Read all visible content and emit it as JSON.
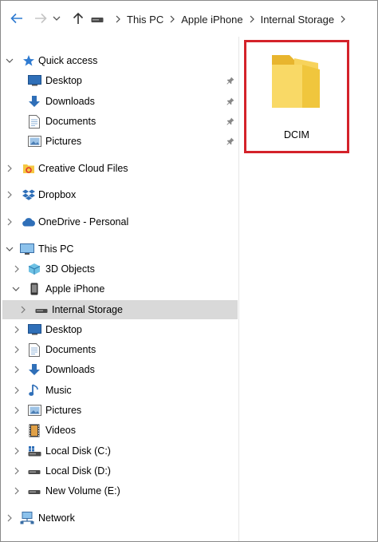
{
  "breadcrumb": [
    "This PC",
    "Apple iPhone",
    "Internal Storage"
  ],
  "colors": {
    "accent": "#2f7bd1",
    "selection": "#d9d9d9",
    "highlight_border": "#d4222a",
    "folder": "#f5c842"
  },
  "nav": {
    "quick_access": {
      "label": "Quick access",
      "items": [
        {
          "label": "Desktop",
          "icon": "desktop-icon",
          "pinned": true
        },
        {
          "label": "Downloads",
          "icon": "downloads-icon",
          "pinned": true
        },
        {
          "label": "Documents",
          "icon": "documents-icon",
          "pinned": true
        },
        {
          "label": "Pictures",
          "icon": "pictures-icon",
          "pinned": true
        }
      ]
    },
    "creative_cloud": {
      "label": "Creative Cloud Files",
      "icon": "creative-cloud-icon"
    },
    "dropbox": {
      "label": "Dropbox",
      "icon": "dropbox-icon"
    },
    "onedrive": {
      "label": "OneDrive - Personal",
      "icon": "onedrive-icon"
    },
    "this_pc": {
      "label": "This PC",
      "items": [
        {
          "label": "3D Objects",
          "icon": "3d-objects-icon"
        },
        {
          "label": "Apple iPhone",
          "icon": "phone-icon"
        },
        {
          "label": "Internal Storage",
          "icon": "drive-icon",
          "selected": true
        },
        {
          "label": "Desktop",
          "icon": "desktop-icon"
        },
        {
          "label": "Documents",
          "icon": "documents-icon"
        },
        {
          "label": "Downloads",
          "icon": "downloads-icon"
        },
        {
          "label": "Music",
          "icon": "music-icon"
        },
        {
          "label": "Pictures",
          "icon": "pictures-icon"
        },
        {
          "label": "Videos",
          "icon": "videos-icon"
        },
        {
          "label": "Local Disk (C:)",
          "icon": "local-disk-c-icon"
        },
        {
          "label": "Local Disk (D:)",
          "icon": "drive-icon"
        },
        {
          "label": "New Volume (E:)",
          "icon": "drive-icon"
        }
      ]
    },
    "network": {
      "label": "Network",
      "icon": "network-icon"
    }
  },
  "content": {
    "items": [
      {
        "name": "DCIM",
        "icon": "folder-icon",
        "highlighted": true
      }
    ]
  }
}
